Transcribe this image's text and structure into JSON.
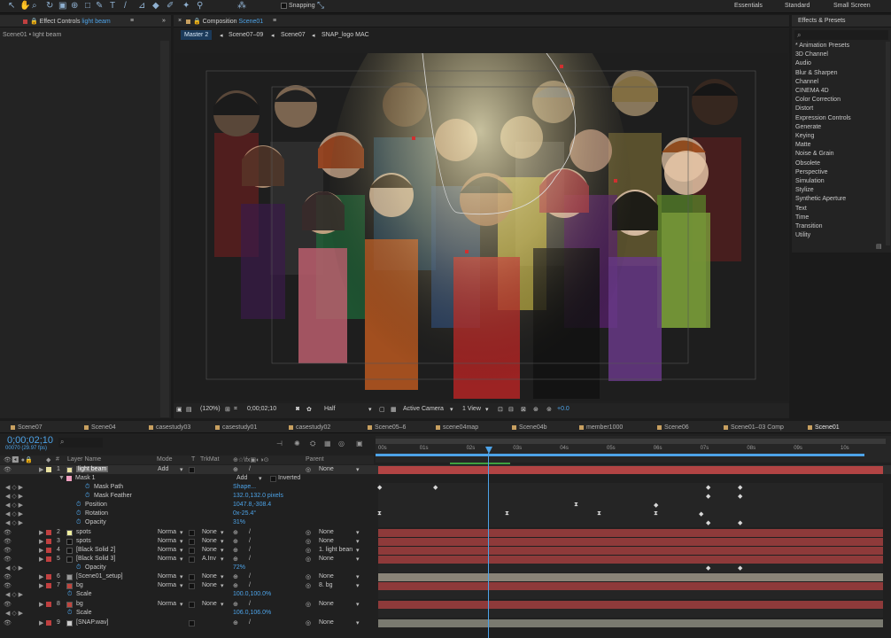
{
  "toolbar": {
    "snapping_label": "Snapping",
    "workspaces": [
      "Essentials",
      "Standard",
      "Small Screen"
    ]
  },
  "effect_controls": {
    "tab_prefix": "Effect Controls",
    "layer_name": "light beam",
    "breadcrumb": "Scene01 • light beam"
  },
  "composition": {
    "tab_prefix": "Composition",
    "comp_name": "Scene01",
    "flow": [
      "Master 2",
      "Scene07–09",
      "Scene07",
      "SNAP_logo MAC"
    ],
    "zoom": "(120%)",
    "timecode": "0;00;02;10",
    "resolution": "Half",
    "camera": "Active Camera",
    "view": "1 View",
    "exposure": "+0.0"
  },
  "effects_presets": {
    "title": "Effects & Presets",
    "items": [
      "* Animation Presets",
      "3D Channel",
      "Audio",
      "Blur & Sharpen",
      "Channel",
      "CINEMA 4D",
      "Color Correction",
      "Distort",
      "Expression Controls",
      "Generate",
      "Keying",
      "Matte",
      "Noise & Grain",
      "Obsolete",
      "Perspective",
      "Simulation",
      "Stylize",
      "Synthetic Aperture",
      "Text",
      "Time",
      "Transition",
      "Utility"
    ]
  },
  "timeline": {
    "tabs": [
      "Scene07",
      "Scene04",
      "casestudy03",
      "casestudy01",
      "casestudy02",
      "Scene05–6",
      "scene04map",
      "Scene04b",
      "member1000",
      "Scene06",
      "Scene01–03 Comp",
      "Scene01"
    ],
    "timecode": "0;00;02;10",
    "frame_info": "00070 (29.97 fps)",
    "search_placeholder": "",
    "headers": {
      "layer_name": "Layer Name",
      "mode": "Mode",
      "t": "T",
      "trkmat": "TrkMat",
      "parent": "Parent"
    },
    "ruler": [
      "00s",
      "01s",
      "02s",
      "03s",
      "04s",
      "05s",
      "06s",
      "07s",
      "08s",
      "09s",
      "10s"
    ],
    "playhead_sec": 2.33,
    "layers": [
      {
        "num": "1",
        "name": "light beam",
        "mode": "Add",
        "trkmat": "",
        "parent": "None",
        "color": "#e8e0a0",
        "selected": true
      },
      {
        "num": "2",
        "name": "spots",
        "mode": "Norma",
        "trkmat": "None",
        "parent": "None",
        "color": "#f0f0a0"
      },
      {
        "num": "3",
        "name": "spots",
        "mode": "Norma",
        "trkmat": "None",
        "parent": "None",
        "color": "#111111"
      },
      {
        "num": "4",
        "name": "[Black Solid 2]",
        "mode": "Norma",
        "trkmat": "None",
        "parent": "1. light bean",
        "color": "#111111"
      },
      {
        "num": "5",
        "name": "[Black Solid 3]",
        "mode": "Norma",
        "trkmat": "A.Inv",
        "parent": "None",
        "color": "#111111"
      },
      {
        "num": "6",
        "name": "[Scene01_setup]",
        "mode": "Norma",
        "trkmat": "None",
        "parent": "None",
        "color": "#999999"
      },
      {
        "num": "7",
        "name": "bg",
        "mode": "Norma",
        "trkmat": "None",
        "parent": "8. bg",
        "color": "#c0463f"
      },
      {
        "num": "8",
        "name": "bg",
        "mode": "Norma",
        "trkmat": "None",
        "parent": "None",
        "color": "#c0463f"
      },
      {
        "num": "9",
        "name": "[SNAP.wav]",
        "mode": "",
        "trkmat": "",
        "parent": "None",
        "color": "#cccccc"
      }
    ],
    "props": {
      "mask1": "Mask 1",
      "mask_mode": "Add",
      "inverted": "Inverted",
      "mask_path": "Mask Path",
      "mask_path_val": "Shape...",
      "mask_feather": "Mask Feather",
      "mask_feather_val": "132.0,132.0 pixels",
      "position": "Position",
      "position_val": "1047.8,-308.4",
      "rotation": "Rotation",
      "rotation_val": "0x-25.4°",
      "opacity": "Opacity",
      "opacity_val": "31%",
      "opacity5": "Opacity",
      "opacity5_val": "72%",
      "scale7": "Scale",
      "scale7_val": "100.0,100.0%",
      "scale8": "Scale",
      "scale8_val": "106.0,106.0%"
    }
  },
  "colors": {
    "accent": "#4da3e8",
    "layer_bar": "#8e3a3a",
    "selected_bar": "#b24444",
    "setup_bar": "#8a8478",
    "audio_bar": "#7a7a70"
  }
}
